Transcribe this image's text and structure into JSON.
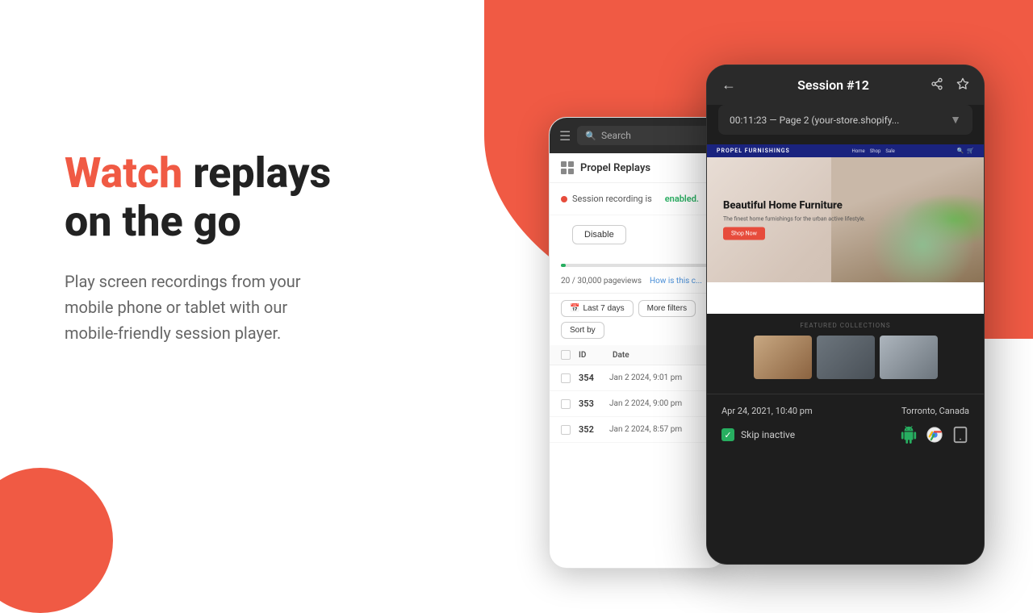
{
  "background": {
    "topRightColor": "#f05a44",
    "bottomLeftColor": "#f05a44"
  },
  "leftContent": {
    "headline": {
      "watch": "Watch",
      "rest": " replays\non the go"
    },
    "subtext": "Play screen recordings from your\nmobile phone or tablet with our\nmobile-friendly session player."
  },
  "phoneLeft": {
    "header": {
      "searchPlaceholder": "Search"
    },
    "appTitle": "Propel Replays",
    "recordingStatus": {
      "label": "Session recording is",
      "status": "enabled.",
      "disableButton": "Disable"
    },
    "progress": {
      "text": "20 / 30,000 pageviews",
      "link": "How is this c..."
    },
    "filters": {
      "lastDays": "Last 7 days",
      "moreFilters": "More filters",
      "sortBy": "Sort by"
    },
    "table": {
      "columns": [
        "ID",
        "Date"
      ],
      "rows": [
        {
          "id": "354",
          "date": "Jan 2 2024, 9:01 pm"
        },
        {
          "id": "353",
          "date": "Jan 2 2024, 9:00 pm"
        },
        {
          "id": "352",
          "date": "Jan 2 2024, 8:57 pm"
        }
      ]
    }
  },
  "phoneRight": {
    "header": {
      "backBtn": "←",
      "title": "Session #12",
      "shareIcon": "share",
      "starIcon": "star"
    },
    "urlBar": {
      "text": "00:11:23 — Page 2 (your-store.shopify...",
      "arrow": "▼"
    },
    "store": {
      "logoText": "PROPEL FURNISHINGS",
      "nav": [
        "Home",
        "Shop",
        "Sale"
      ],
      "heroTitle": "Beautiful Home Furniture",
      "heroSubtitle": "The finest home furnishings for the urban active lifestyle.",
      "heroButton": "Shop Now",
      "collectionsLabel": "FEATURED COLLECTIONS"
    },
    "footer": {
      "timestamp": "Apr 24, 2021, 10:40 pm",
      "location": "Torronto, Canada",
      "skipInactive": "Skip inactive",
      "skipChecked": true,
      "devices": [
        "android",
        "chrome",
        "tablet"
      ]
    }
  }
}
